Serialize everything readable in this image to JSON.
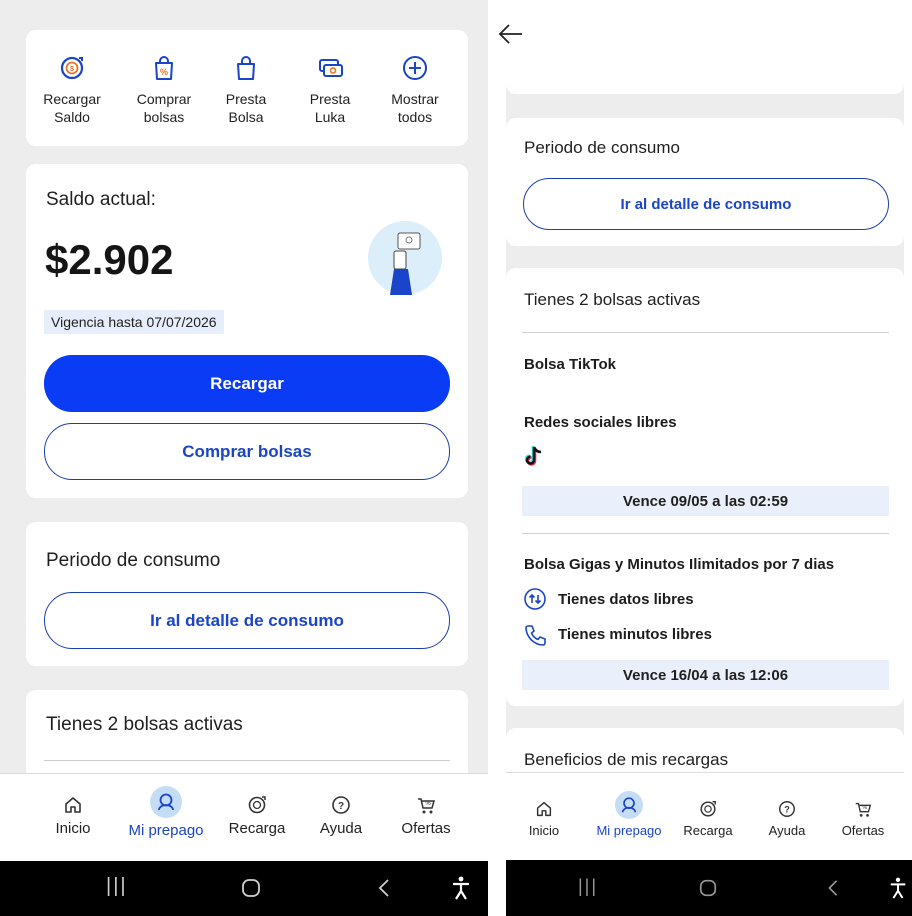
{
  "left": {
    "quick_actions": [
      {
        "icon": "recharge-icon",
        "label": "Recargar\nSaldo"
      },
      {
        "icon": "bag-percent-icon",
        "label": "Comprar\nbolsas"
      },
      {
        "icon": "bag-icon",
        "label": "Presta\nBolsa"
      },
      {
        "icon": "money-icon",
        "label": "Presta\nLuka"
      },
      {
        "icon": "plus-circle-icon",
        "label": "Mostrar\ntodos"
      }
    ],
    "balance": {
      "heading": "Saldo actual:",
      "amount": "$2.902",
      "validity": "Vigencia hasta 07/07/2026",
      "recharge_label": "Recargar",
      "buy_label": "Comprar bolsas"
    },
    "consumption": {
      "heading": "Periodo de consumo",
      "detail_label": "Ir al detalle de consumo"
    },
    "bags": {
      "heading": "Tienes 2 bolsas activas"
    }
  },
  "right": {
    "consumption": {
      "heading": "Periodo de consumo",
      "detail_label": "Ir al detalle de consumo"
    },
    "bags": {
      "heading": "Tienes 2 bolsas activas",
      "items": [
        {
          "name": "Bolsa TikTok",
          "subtitle": "Redes sociales libres",
          "expiry": "Vence 09/05 a las 02:59"
        },
        {
          "name": "Bolsa Gigas y Minutos Ilimitados por 7 dias",
          "data_label": "Tienes datos libres",
          "minutes_label": "Tienes minutos libres",
          "expiry": "Vence 16/04 a las 12:06"
        }
      ]
    },
    "benefits": {
      "heading": "Beneficios de mis recargas"
    }
  },
  "nav": {
    "items": [
      {
        "icon": "home-icon",
        "label": "Inicio"
      },
      {
        "icon": "profile-icon",
        "label": "Mi prepago"
      },
      {
        "icon": "recharge-icon",
        "label": "Recarga"
      },
      {
        "icon": "help-icon",
        "label": "Ayuda"
      },
      {
        "icon": "offers-icon",
        "label": "Ofertas"
      }
    ],
    "active_color": "#1a44c9"
  },
  "colors": {
    "primary": "#0a3cf5",
    "accent_orange": "#e8742a",
    "background": "#ededed"
  }
}
